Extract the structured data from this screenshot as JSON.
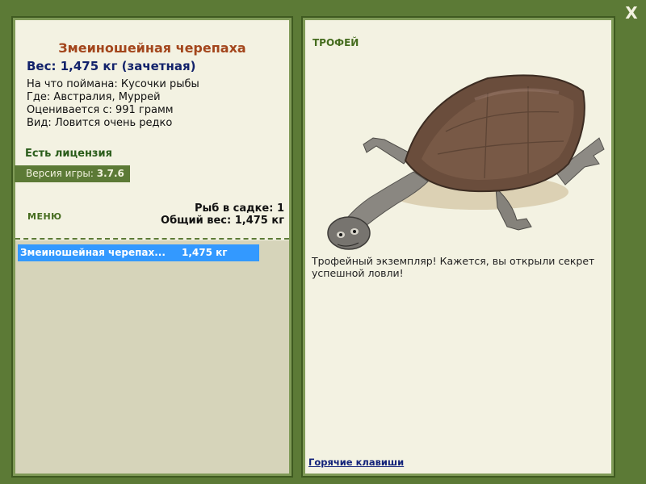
{
  "close_label": "X",
  "fish": {
    "name": "Змеиношейная черепаха",
    "weight_line": "Вес: 1,475 кг (зачетная)",
    "details": [
      "На что поймана: Кусочки рыбы",
      "Где: Австралия, Муррей",
      "Оценивается с: 991 грамм",
      "Вид: Ловится очень редко"
    ]
  },
  "license_text": "Есть лицензия",
  "version": {
    "label": "Версия игры:",
    "value": "3.7.6"
  },
  "menu_label": "МЕНЮ",
  "keep": {
    "count_line": "Рыб в садке: 1",
    "total_line": "Общий вес: 1,475 кг"
  },
  "catch_list": [
    {
      "name": "Змеиношейная черепах...",
      "weight": "1,475 кг"
    }
  ],
  "trophy": {
    "label": "ТРОФЕЙ",
    "message": "Трофейный экземпляр! Кажется, вы открыли секрет успешной ловли!"
  },
  "hotkeys_label": "Горячие клавиши",
  "colors": {
    "frame_green": "#5c7a36",
    "panel_bg": "#f3f2e2",
    "title_brown": "#a3461c",
    "weight_navy": "#13236b",
    "selection_blue": "#3399ff"
  }
}
